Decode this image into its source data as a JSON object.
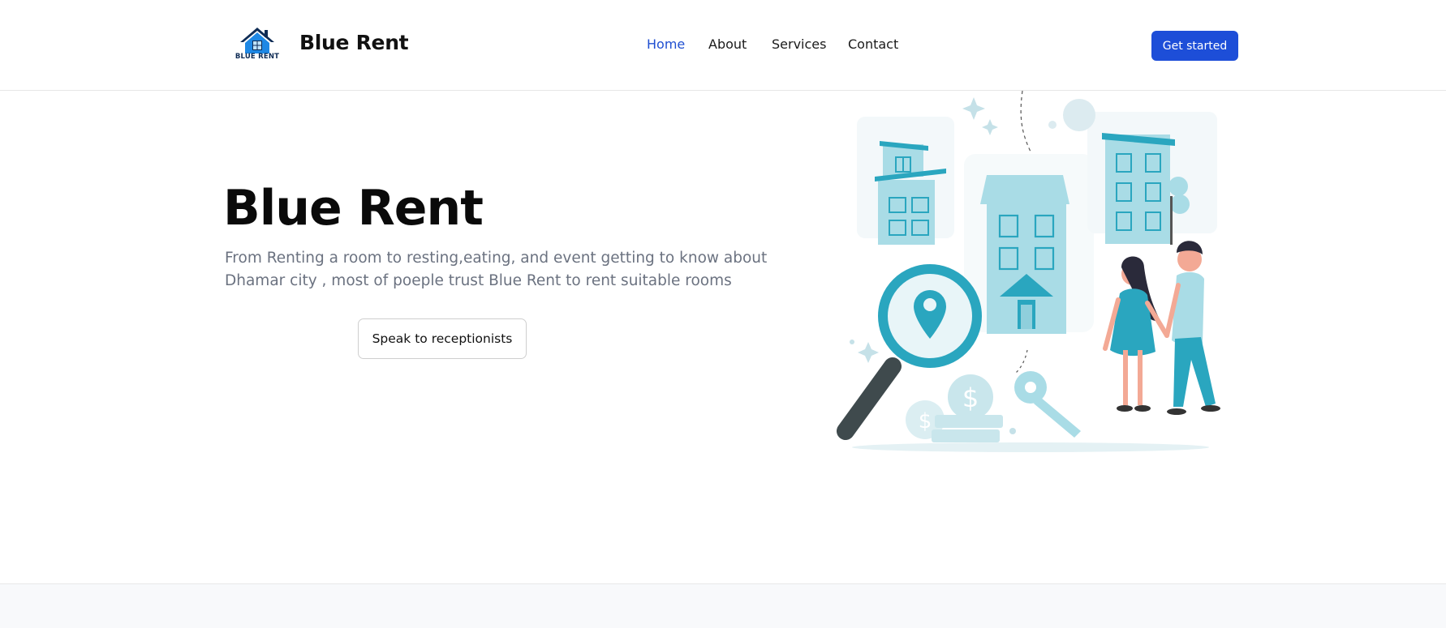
{
  "header": {
    "logo_caption": "BLUE RENT",
    "brand_name": "Blue Rent",
    "nav": {
      "home": "Home",
      "about": "About",
      "services": "Services",
      "contact": "Contact"
    },
    "active_nav": "Home",
    "cta_label": "Get started"
  },
  "hero": {
    "title": "Blue Rent",
    "description": "From Renting a room to resting,eating, and event getting to know about Dhamar city , most of poeple trust Blue Rent to rent suitable rooms",
    "button_label": "Speak to receptionists",
    "illustration_icon": "house-rental-illustration"
  },
  "colors": {
    "accent": "#1d4ed8",
    "active_link": "#1f4fd1",
    "illustration_teal": "#2aa6bf",
    "illustration_light": "#a9dce6",
    "muted_text": "#6b7280",
    "bottom_band": "#f8f9fb"
  }
}
